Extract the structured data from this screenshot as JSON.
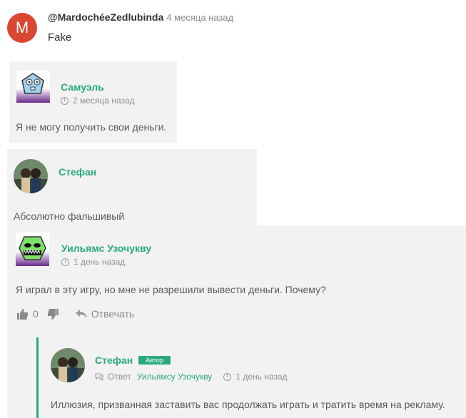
{
  "comment1": {
    "avatar_letter": "M",
    "author": "@MardochéeZedlubinda",
    "time": "4 месяца назад",
    "text": "Fake"
  },
  "reply1": {
    "author": "Самуэль",
    "time": "2 месяца назад",
    "text": "Я не могу получить свои деньги."
  },
  "reply2": {
    "author": "Стефан",
    "text": "Абсолютно фальшивый"
  },
  "reply3": {
    "author": "Уильямс Узочукву",
    "time": "1 день назад",
    "text": "Я играл в эту игру, но мне не разрешили вывести деньги. Почему?",
    "likes": "0",
    "reply_label": "Отвечать"
  },
  "reply4": {
    "author": "Стефан",
    "badge": "Автор",
    "reply_prefix": "Ответ",
    "reply_to": "Уильямсу Узочукву",
    "time": "1 день назад",
    "text": "Иллюзия, призванная заставить вас продолжать играть и тратить время на рекламу."
  },
  "colors": {
    "accent": "#2aaa7c",
    "avatar_red": "#d94731",
    "card_bg": "#f2f2f2"
  }
}
